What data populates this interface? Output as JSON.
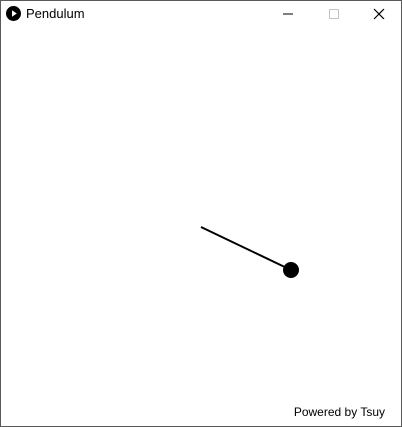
{
  "window": {
    "title": "Pendulum",
    "icon": "play-icon",
    "controls": {
      "minimize_icon": "minimize-icon",
      "maximize_icon": "maximize-icon",
      "close_icon": "close-icon"
    }
  },
  "scene": {
    "pendulum_color": "#000000",
    "background_color": "#ffffff"
  },
  "footer": {
    "credit": "Powered by Tsuy"
  }
}
